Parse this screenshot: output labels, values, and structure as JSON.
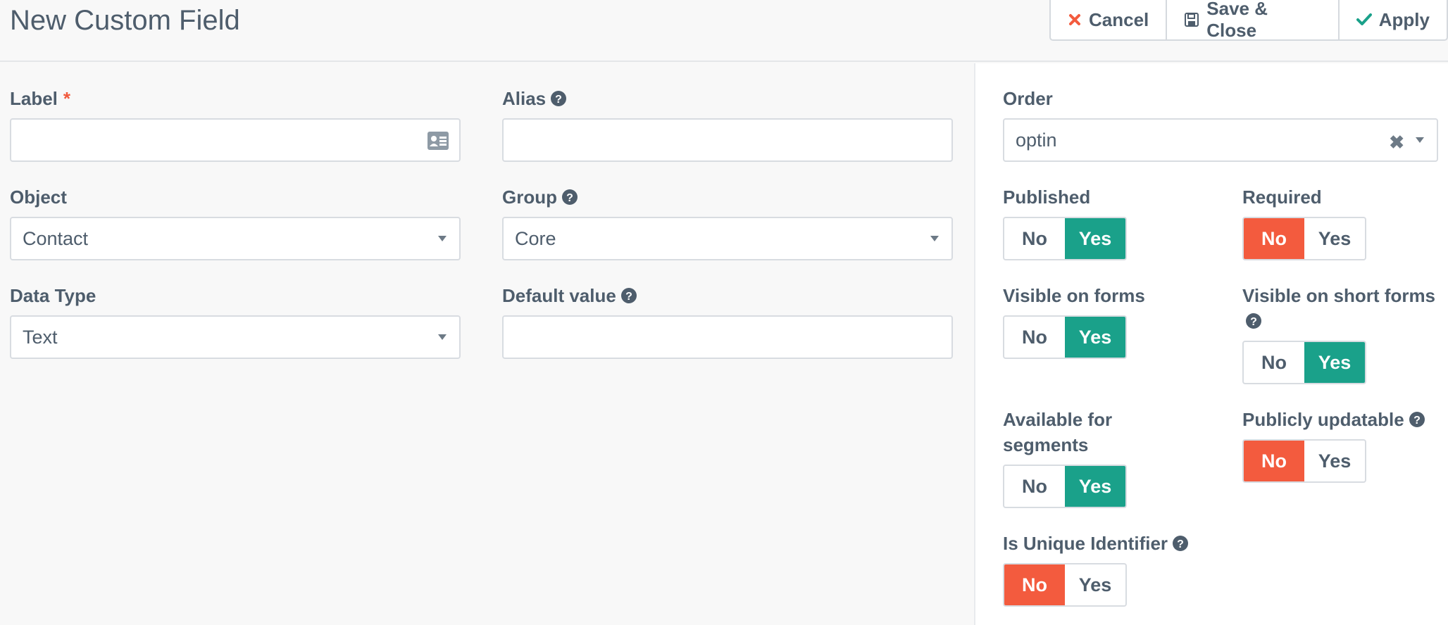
{
  "header": {
    "title": "New Custom Field",
    "cancel_label": "Cancel",
    "save_close_label": "Save & Close",
    "apply_label": "Apply"
  },
  "form": {
    "label": {
      "label": "Label",
      "required_mark": "*",
      "value": ""
    },
    "alias": {
      "label": "Alias",
      "value": ""
    },
    "object": {
      "label": "Object",
      "value": "Contact"
    },
    "group": {
      "label": "Group",
      "value": "Core"
    },
    "data_type": {
      "label": "Data Type",
      "value": "Text"
    },
    "default_value": {
      "label": "Default value",
      "value": ""
    }
  },
  "side": {
    "order": {
      "label": "Order",
      "value": "optin",
      "clear": "✖"
    },
    "toggles": {
      "no": "No",
      "yes": "Yes",
      "published": {
        "label": "Published",
        "selected": "Yes"
      },
      "required": {
        "label": "Required",
        "selected": "No"
      },
      "visible_forms": {
        "label": "Visible on forms",
        "selected": "Yes"
      },
      "visible_short_forms": {
        "label": "Visible on short forms",
        "selected": "Yes"
      },
      "available_segments": {
        "label_line1": "Available for",
        "label_line2": "segments",
        "selected": "Yes"
      },
      "publicly_updatable": {
        "label": "Publicly updatable",
        "selected": "No"
      },
      "unique_identifier": {
        "label": "Is Unique Identifier",
        "selected": "No"
      }
    }
  },
  "colors": {
    "yes_active": "#1aa18a",
    "no_active": "#f35b3e",
    "required_star": "#f1593c"
  },
  "icons": {
    "cancel": "close-icon",
    "save": "floppy-disk-icon",
    "apply": "check-icon",
    "help": "question-circle-icon",
    "contact_card": "id-card-icon"
  }
}
